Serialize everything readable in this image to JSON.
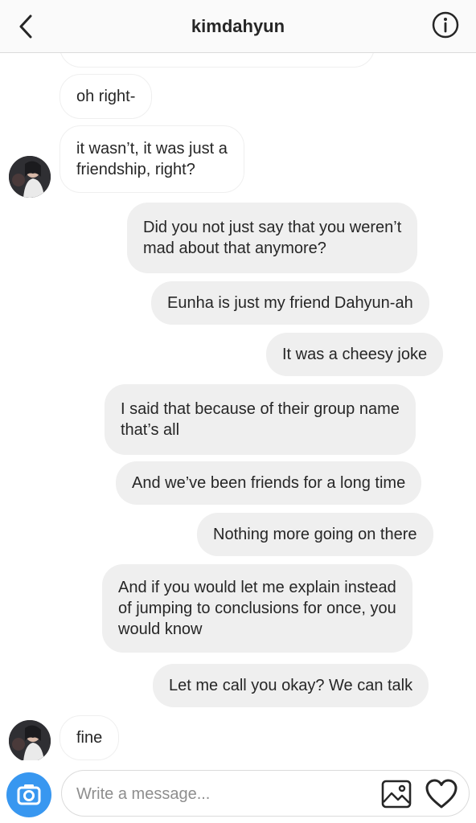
{
  "header": {
    "title": "kimdahyun",
    "back_icon": "chevron-left-icon",
    "info_icon": "info-icon"
  },
  "messages": [
    {
      "from": "them",
      "text": "oh right-"
    },
    {
      "from": "them",
      "lines": [
        "it wasn’t, it was just a",
        "friendship, right?"
      ]
    },
    {
      "from": "me",
      "lines": [
        "Did you not just say that you weren’t",
        "mad about that anymore?"
      ]
    },
    {
      "from": "me",
      "text": "Eunha is just my friend Dahyun-ah"
    },
    {
      "from": "me",
      "text": "It was a cheesy joke"
    },
    {
      "from": "me",
      "lines": [
        "I said that because of their group name",
        "that’s all"
      ]
    },
    {
      "from": "me",
      "text": "And we’ve been friends for a long time"
    },
    {
      "from": "me",
      "text": "Nothing more going on there"
    },
    {
      "from": "me",
      "lines": [
        "And if you would let me explain instead",
        "of jumping to conclusions for once, you",
        "would know"
      ]
    },
    {
      "from": "me",
      "text": "Let me call you okay? We can talk"
    },
    {
      "from": "them",
      "text": "fine"
    }
  ],
  "composer": {
    "placeholder": "Write a message...",
    "camera_icon": "camera-icon",
    "gallery_icon": "image-icon",
    "heart_icon": "heart-icon"
  },
  "colors": {
    "accent": "#3897f0",
    "outgoing_bubble": "#efefef",
    "text": "#262626",
    "placeholder": "#8e8e8e"
  }
}
